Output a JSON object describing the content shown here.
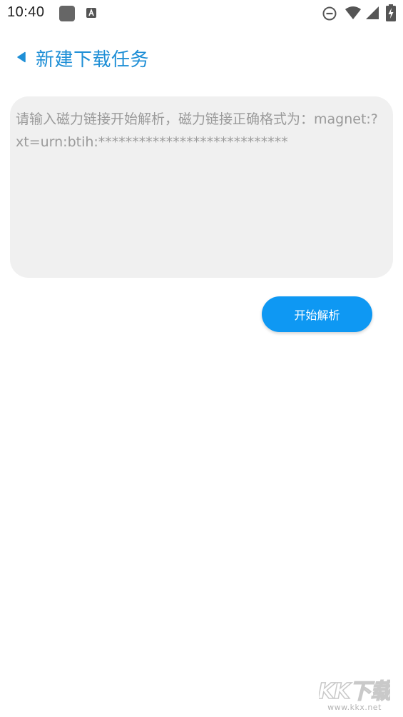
{
  "status_bar": {
    "time": "10:40",
    "icons": [
      "notification-square-icon",
      "notification-a-icon",
      "do-not-disturb-icon",
      "wifi-icon",
      "cellular-signal-icon",
      "battery-charging-icon"
    ]
  },
  "header": {
    "back_icon": "back-triangle-icon",
    "title": "新建下载任务"
  },
  "magnet_input": {
    "value": "",
    "placeholder": "请输入磁力链接开始解析，磁力链接正确格式为：magnet:?xt=urn:btih:****************************"
  },
  "parse_button": {
    "label": "开始解析"
  },
  "watermark": {
    "text": "KK下载",
    "url": "www.kkx.net"
  },
  "colors": {
    "accent": "#1f8fd6",
    "button": "#0e98f3",
    "input_bg": "#f0f0f0",
    "placeholder": "#9a9a9a"
  }
}
